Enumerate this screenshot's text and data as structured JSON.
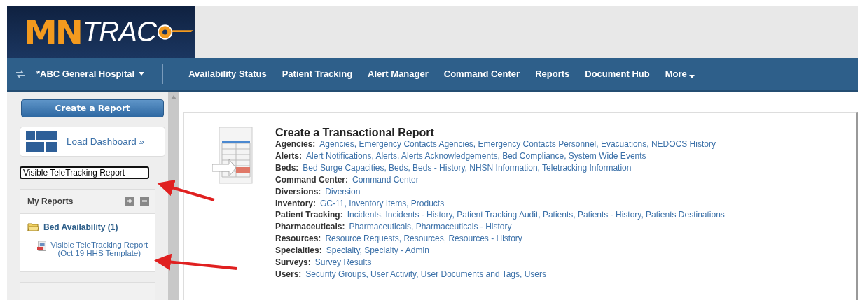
{
  "header": {
    "logo": {
      "part_1": "MN",
      "part_2": "TRAC"
    }
  },
  "nav": {
    "facility": "*ABC General Hospital",
    "items": [
      {
        "label": "Availability Status",
        "kind": "link"
      },
      {
        "label": "Patient Tracking",
        "kind": "link"
      },
      {
        "label": "Alert Manager",
        "kind": "link"
      },
      {
        "label": "Command Center",
        "kind": "link"
      },
      {
        "label": "Reports",
        "kind": "link"
      },
      {
        "label": "Document Hub",
        "kind": "link"
      },
      {
        "label": "More",
        "kind": "dropdown"
      }
    ]
  },
  "sidebar": {
    "create_button": "Create a Report",
    "load_dashboard": "Load Dashboard »",
    "search_field": {
      "value": "Visible TeleTracking Report"
    },
    "my_reports": {
      "title": "My Reports",
      "folders": [
        {
          "label": "Bed Availability (1)",
          "expanded": true,
          "children": [
            {
              "label": "Visible TeleTracking Report (Oct 19 HHS Template)"
            }
          ]
        }
      ]
    }
  },
  "content": {
    "title": "Create a Transactional Report",
    "categories": [
      {
        "label": "Agencies:",
        "links": "Agencies, Emergency Contacts Agencies, Emergency Contacts Personnel, Evacuations, NEDOCS History"
      },
      {
        "label": "Alerts:",
        "links": "Alert Notifications, Alerts, Alerts Acknowledgements, Bed Compliance, System Wide Events"
      },
      {
        "label": "Beds:",
        "links": "Bed Surge Capacities, Beds, Beds - History, NHSN Information, Teletracking Information"
      },
      {
        "label": "Command Center:",
        "links": "Command Center"
      },
      {
        "label": "Diversions:",
        "links": "Diversion"
      },
      {
        "label": "Inventory:",
        "links": "GC-11, Inventory Items, Products"
      },
      {
        "label": "Patient Tracking:",
        "links": "Incidents, Incidents - History, Patient Tracking Audit, Patients, Patients - History, Patients Destinations"
      },
      {
        "label": "Pharmaceuticals:",
        "links": "Pharmaceuticals, Pharmaceuticals - History"
      },
      {
        "label": "Resources:",
        "links": "Resource Requests, Resources, Resources - History"
      },
      {
        "label": "Specialties:",
        "links": "Specialty, Specialty - Admin"
      },
      {
        "label": "Surveys:",
        "links": "Survey Results"
      },
      {
        "label": "Users:",
        "links": "Security Groups, User Activity, User Documents and Tags, Users"
      }
    ]
  }
}
